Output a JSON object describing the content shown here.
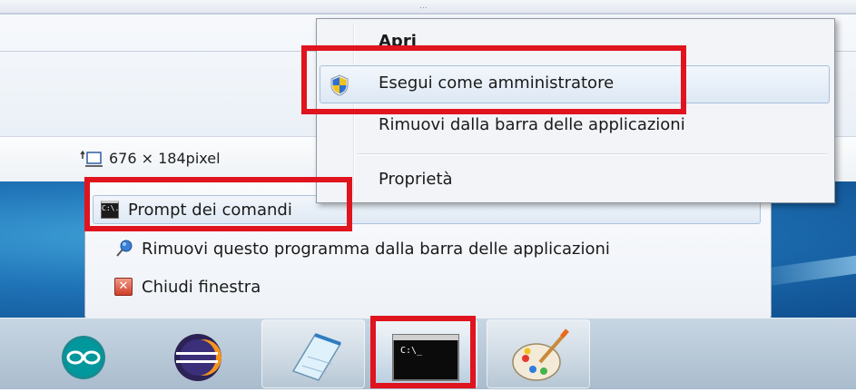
{
  "paint_window": {
    "grip_glyph": "…",
    "status": {
      "pixel_size": "676 × 184pixel",
      "resize_icon": "resize-canvas-icon"
    }
  },
  "jump_list": {
    "items": [
      {
        "label": "Prompt dei comandi",
        "icon": "command-prompt-icon",
        "highlighted": true
      },
      {
        "label": "Rimuovi questo programma dalla barra delle applicazioni",
        "icon": "unpin-icon"
      },
      {
        "label": "Chiudi finestra",
        "icon": "close-window-icon"
      }
    ],
    "cmd_mini_text": "C:\\."
  },
  "context_menu": {
    "items": [
      {
        "label": "Apri",
        "bold": true
      },
      {
        "label": "Esegui come amministratore",
        "icon": "uac-shield-icon",
        "highlighted": true
      },
      {
        "label": "Rimuovi dalla barra delle applicazioni"
      },
      {
        "label": "Proprietà"
      }
    ]
  },
  "taskbar": {
    "buttons": [
      {
        "app": "Arduino",
        "icon": "arduino-icon"
      },
      {
        "app": "Eclipse",
        "icon": "eclipse-icon"
      },
      {
        "app": "Notepad",
        "icon": "notepad-icon"
      },
      {
        "app": "Command Prompt",
        "icon": "command-prompt-icon",
        "active": true,
        "text": "C:\\_"
      },
      {
        "app": "Paint",
        "icon": "paint-palette-icon"
      }
    ]
  },
  "annotation_color": "#e0141e"
}
